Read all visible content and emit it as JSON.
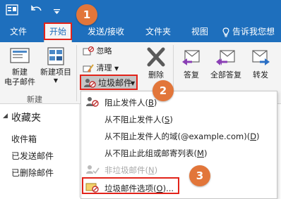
{
  "tabs": {
    "file": "文件",
    "home": "开始",
    "send_receive": "发送/接收",
    "folder": "文件夹",
    "view": "视图",
    "tell_me": "告诉我您想"
  },
  "ribbon": {
    "new_email": [
      "新建",
      "电子邮件"
    ],
    "new_items": "新建项目",
    "group_new": "新建",
    "ignore": "忽略",
    "clean": "清理",
    "junk": "垃圾邮件",
    "delete": "删除",
    "reply": "答复",
    "reply_all": "全部答复",
    "forward": "转发"
  },
  "folders": {
    "favorites": "收藏夹",
    "inbox": "收件箱",
    "sent": "已发送邮件",
    "deleted": "已删除邮件"
  },
  "menu": {
    "items": [
      {
        "label": "阻止发件人",
        "key": "B",
        "disabled": false
      },
      {
        "label": "从不阻止发件人",
        "key": "S",
        "disabled": false
      },
      {
        "label": "从不阻止发件人的域(@example.com)",
        "key": "D",
        "disabled": false
      },
      {
        "label": "从不阻止此组或邮寄列表",
        "key": "M",
        "disabled": false
      },
      {
        "label": "非垃圾邮件",
        "key": "N",
        "disabled": true
      },
      {
        "label": "垃圾邮件选项",
        "key": "O",
        "suffix": "...",
        "disabled": false
      }
    ]
  },
  "badges": [
    "1",
    "2",
    "3"
  ],
  "colors": {
    "accent": "#1e6fbd",
    "highlight": "#e2231a",
    "badge": "#e2763a"
  }
}
